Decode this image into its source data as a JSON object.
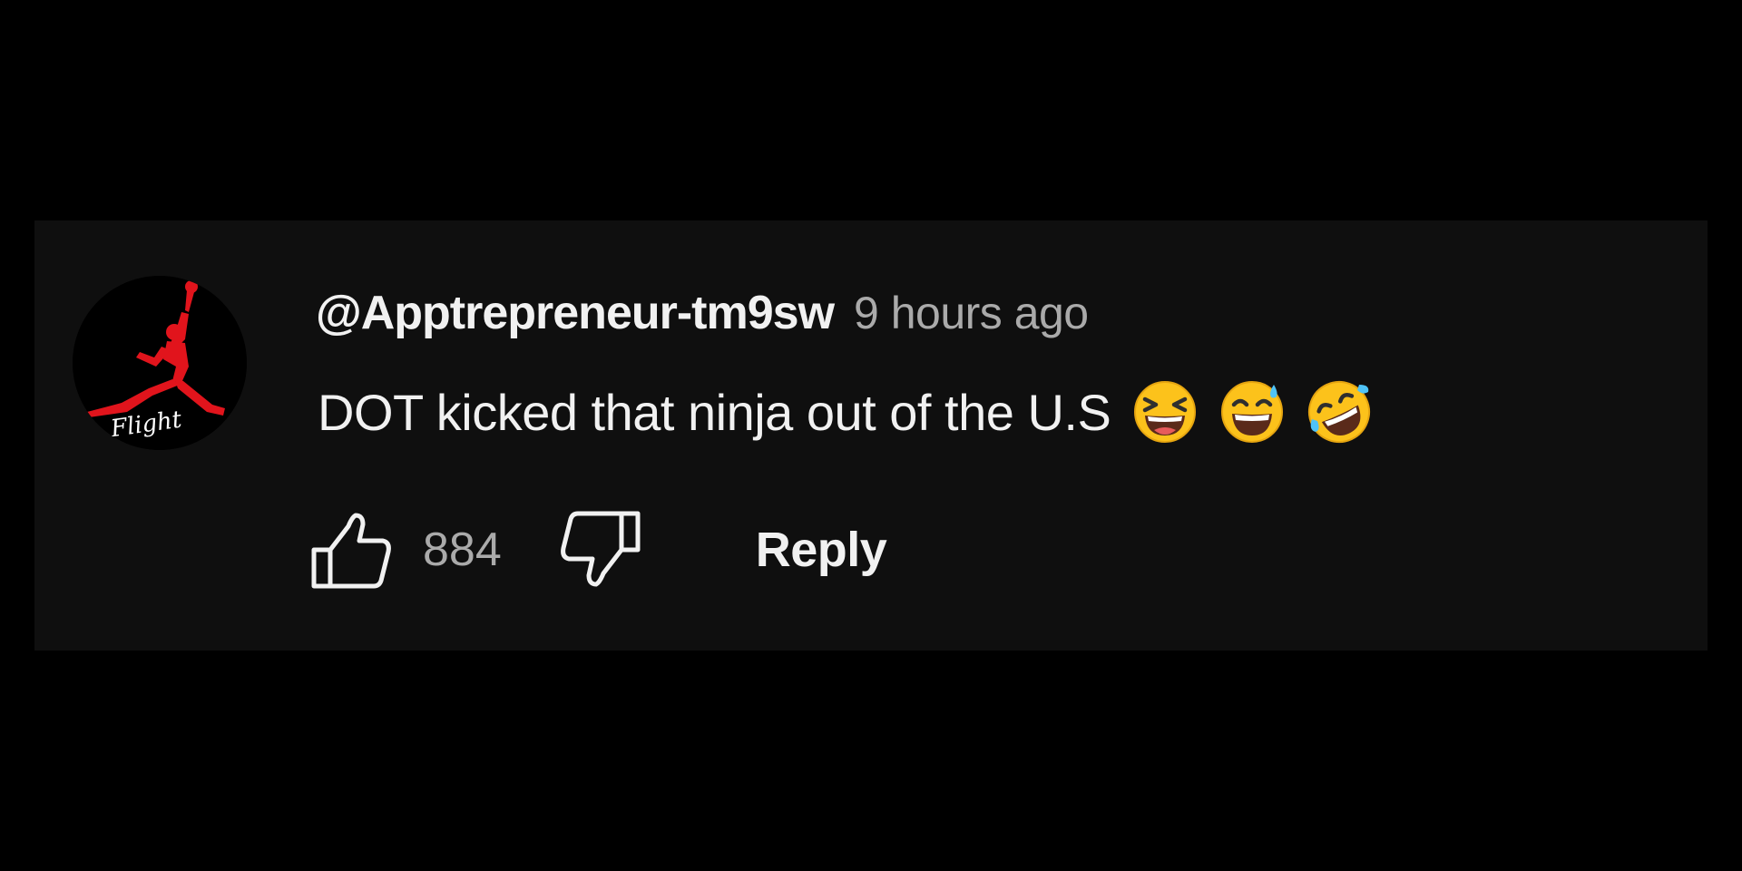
{
  "comment": {
    "avatar": {
      "icon": "jumpman-logo-icon",
      "logo_text": "Flight",
      "accent_color": "#e1141c"
    },
    "author": "@Apptrepreneur-tm9sw",
    "timestamp": "9 hours ago",
    "text": "DOT kicked that ninja out of the U.S",
    "emojis": [
      "laughing-squinting-face-emoji",
      "grinning-sweat-face-emoji",
      "rolling-on-floor-laughing-emoji"
    ],
    "actions": {
      "like_icon": "thumbs-up-icon",
      "like_count": "884",
      "dislike_icon": "thumbs-down-icon",
      "reply_label": "Reply"
    }
  },
  "colors": {
    "page_background": "#000000",
    "card_background": "#0f0f0f",
    "primary_text": "#f1f1f1",
    "secondary_text": "#aaaaaa"
  }
}
